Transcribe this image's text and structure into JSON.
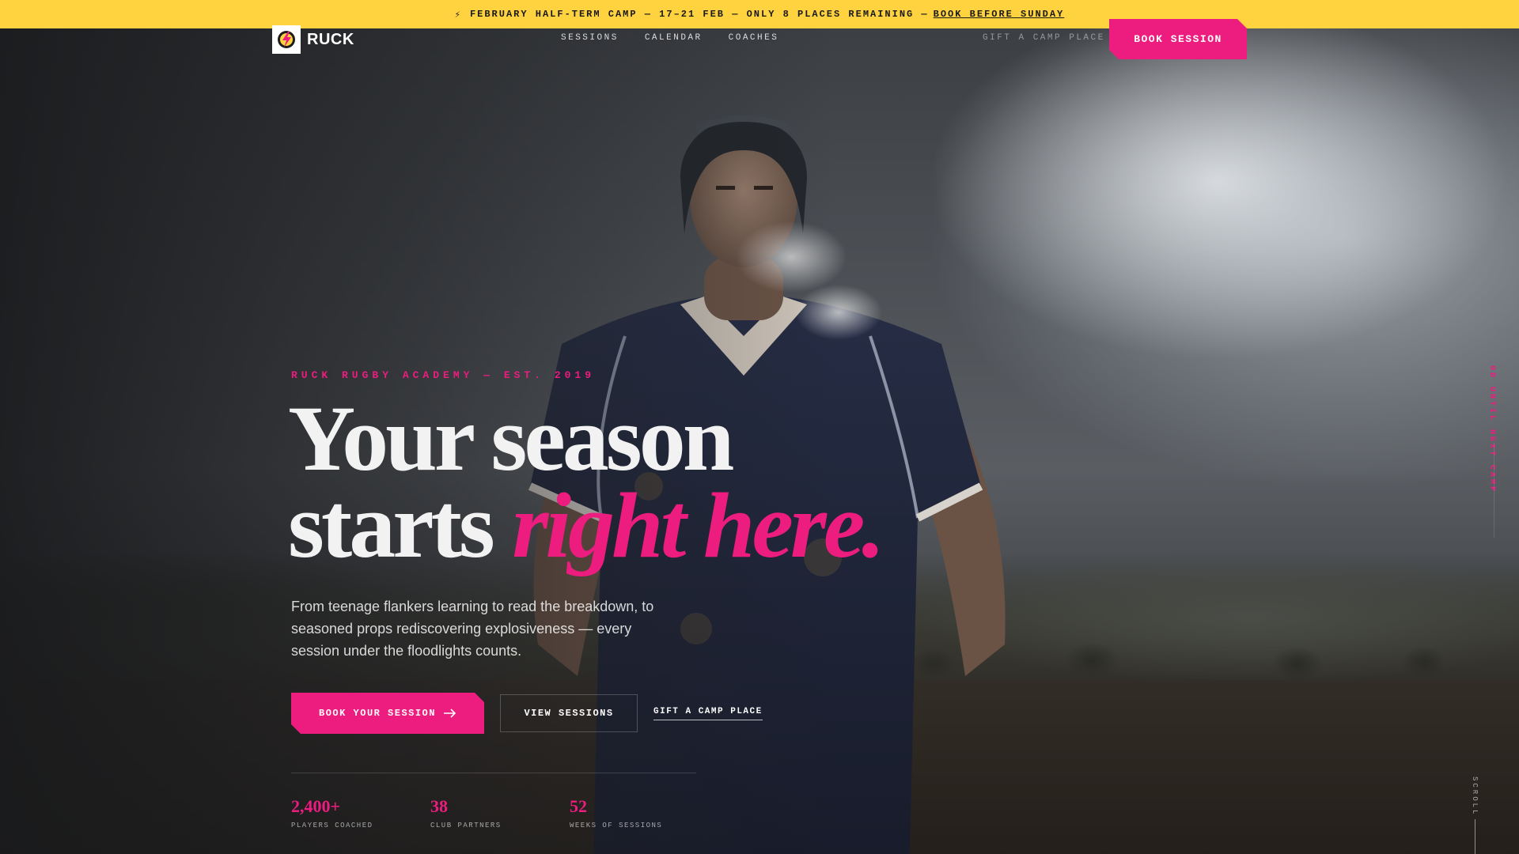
{
  "announcement": {
    "text": "FEBRUARY HALF-TERM CAMP — 17–21 FEB — ONLY 8 PLACES REMAINING —",
    "link": "BOOK BEFORE SUNDAY",
    "icon": "bolt-icon"
  },
  "brand": {
    "name": "RUCK",
    "logo_icon": "lightning-ball-icon"
  },
  "nav": {
    "links": [
      "SESSIONS",
      "CALENDAR",
      "COACHES"
    ],
    "gift": "GIFT A CAMP PLACE",
    "cta": "BOOK SESSION"
  },
  "hero": {
    "eyebrow": "RUCK RUGBY ACADEMY — EST. 2019",
    "headline_line1": "Your season",
    "headline_line2_plain": "starts",
    "headline_line2_accent": "right here.",
    "lede": "From teenage flankers learning to read the breakdown, to seasoned props rediscovering explosiveness — every session under the floodlights counts.",
    "primary_button": "BOOK YOUR SESSION",
    "secondary_button": "VIEW SESSIONS",
    "link_button": "GIFT A CAMP PLACE"
  },
  "stats": [
    {
      "value": "2,400+",
      "label": "PLAYERS COACHED"
    },
    {
      "value": "38",
      "label": "CLUB PARTNERS"
    },
    {
      "value": "52",
      "label": "WEEKS OF SESSIONS"
    }
  ],
  "side": {
    "countdown": "0D UNTIL NEXT CAMP",
    "scroll": "SCROLL"
  },
  "colors": {
    "announcement_bg": "#ffd23f",
    "accent": "#ec1d7f",
    "text": "#f2f2f2"
  }
}
